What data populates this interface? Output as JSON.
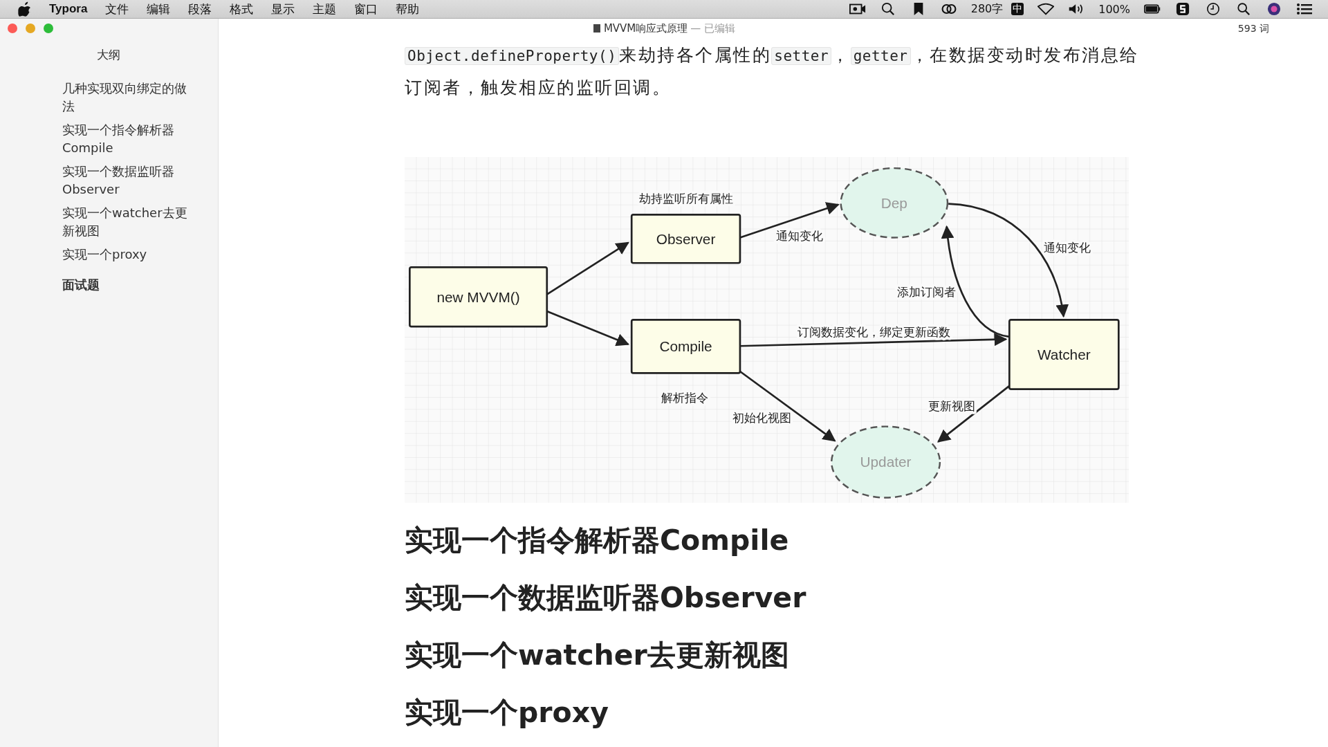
{
  "menu_bar": {
    "app": "Typora",
    "menus": [
      "文件",
      "编辑",
      "段落",
      "格式",
      "显示",
      "主题",
      "窗口",
      "帮助"
    ],
    "word_status": "280字",
    "input_method": "中",
    "battery": "100%"
  },
  "window": {
    "title": "MVVM响应式原理",
    "state": "— 已编辑",
    "word_count": "593 词"
  },
  "sidebar": {
    "title": "大纲",
    "items": [
      {
        "label": "几种实现双向绑定的做法",
        "kind": "sub"
      },
      {
        "label": "实现一个指令解析器Compile",
        "kind": "sub"
      },
      {
        "label": "实现一个数据监听器Observer",
        "kind": "sub"
      },
      {
        "label": "实现一个watcher去更新视图",
        "kind": "sub"
      },
      {
        "label": "实现一个proxy",
        "kind": "sub"
      },
      {
        "label": "面试题",
        "kind": "main"
      }
    ]
  },
  "paragraph": [
    {
      "kind": "code",
      "text": "Object.defineProperty()"
    },
    {
      "kind": "text",
      "text": "来劫持各个属性的"
    },
    {
      "kind": "code",
      "text": "setter"
    },
    {
      "kind": "text",
      "text": "，"
    },
    {
      "kind": "code",
      "text": "getter"
    },
    {
      "kind": "text",
      "text": "，在数据变动时发布消息给订阅者，触发相应的监听回调。"
    }
  ],
  "diagram": {
    "nodes": [
      {
        "label": "new MVVM()",
        "kind": "box"
      },
      {
        "label": "Observer",
        "kind": "box"
      },
      {
        "label": "Compile",
        "kind": "box"
      },
      {
        "label": "Watcher",
        "kind": "box"
      },
      {
        "label": "Dep",
        "kind": "ellipse"
      },
      {
        "label": "Updater",
        "kind": "ellipse"
      }
    ],
    "notes": [
      "劫持监听所有属性",
      "通知变化",
      "通知变化",
      "添加订阅者",
      "订阅数据变化，绑定更新函数",
      "解析指令",
      "初始化视图",
      "更新视图"
    ]
  },
  "headings": [
    "实现一个指令解析器Compile",
    "实现一个数据监听器Observer",
    "实现一个watcher去更新视图",
    "实现一个proxy"
  ]
}
